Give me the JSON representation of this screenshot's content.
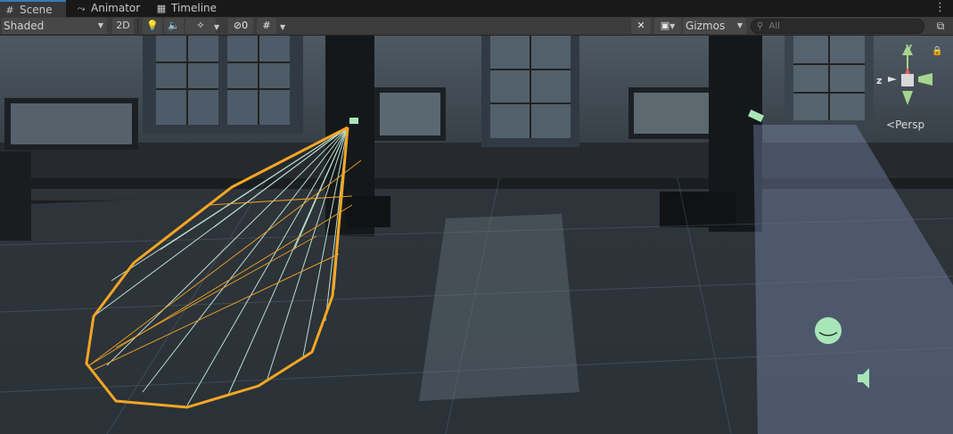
{
  "tabs": [
    {
      "label": "Scene",
      "icon": "grid-icon",
      "active": true
    },
    {
      "label": "Animator",
      "icon": "animator-icon",
      "active": false
    },
    {
      "label": "Timeline",
      "icon": "timeline-icon",
      "active": false
    }
  ],
  "toolbar": {
    "shading_mode": "Shaded",
    "toggle_2d": "2D",
    "hidden_count": "0",
    "gizmos_label": "Gizmos",
    "search_placeholder": "All"
  },
  "scene_gizmo": {
    "projection_label": "Persp",
    "axis_y": "y",
    "axis_z": "z"
  },
  "colors": {
    "accent": "#3a79bb",
    "spotlight_gizmo": "#f5a623",
    "cone_lines": "#c9f0dc",
    "axis_y": "#a7d48f",
    "axis_x": "#e85d5d",
    "axis_z": "#6fa8dc"
  }
}
